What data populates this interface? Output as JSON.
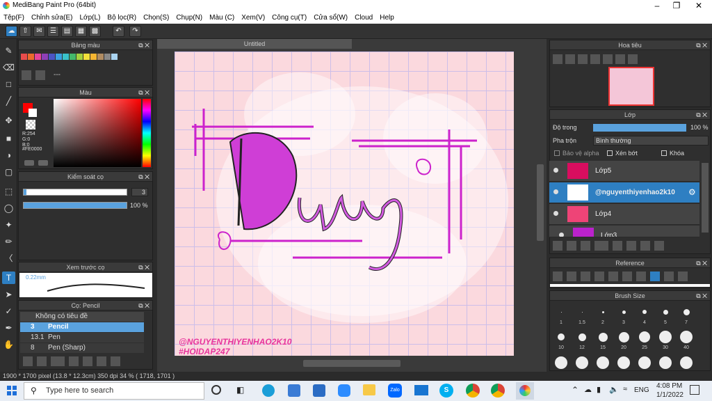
{
  "window": {
    "title": "MediBang Paint Pro (64bit)"
  },
  "menu": [
    "Tệp(F)",
    "Chỉnh sửa(E)",
    "Lớp(L)",
    "Bộ lọc(R)",
    "Chọn(S)",
    "Chụp(N)",
    "Màu (C)",
    "Xem(V)",
    "Công cụ(T)",
    "Cửa sổ(W)",
    "Cloud",
    "Help"
  ],
  "panels": {
    "palette": {
      "title": "Bảng màu",
      "dash": "---"
    },
    "color": {
      "title": "Màu",
      "r": "R:254",
      "g": "G:0",
      "b": "B:0",
      "hex": "#FE0000"
    },
    "brush_control": {
      "title": "Kiểm soát cọ",
      "size": "3",
      "opacity": "100 %"
    },
    "preview": {
      "title": "Xem trước cọ",
      "value": "0.22mm"
    },
    "brush": {
      "title": "Cọ: Pencil",
      "group": "Không có tiêu đề",
      "items": [
        {
          "size": "3",
          "name": "Pencil"
        },
        {
          "size": "13.1",
          "name": "Pen"
        },
        {
          "size": "8",
          "name": "Pen (Sharp)"
        }
      ]
    },
    "navigator": {
      "title": "Hoa tiêu"
    },
    "layers": {
      "title": "Lớp",
      "opacity_label": "Độ trong",
      "opacity_value": "100 %",
      "blend_label": "Pha trộn",
      "blend_value": "Bình thường",
      "protect_alpha": "Bảo vệ alpha",
      "clip": "Xén bớt",
      "lock": "Khóa",
      "items": [
        "Lớp5",
        "@nguyenthiyenhao2k10",
        "Lớp4",
        "Lớp3"
      ]
    },
    "reference": {
      "title": "Reference"
    },
    "brush_size": {
      "title": "Brush Size",
      "sizes": [
        "1",
        "1.5",
        "2",
        "3",
        "4",
        "5",
        "7",
        "10",
        "12",
        "15",
        "20",
        "25",
        "30",
        "40"
      ]
    }
  },
  "canvas": {
    "tab": "Untitled",
    "watermark1": "@NGUYENTHIYENHAO2K10",
    "watermark2": "#HOIDAP247"
  },
  "status": "1900 * 1700 pixel  (13.8 * 12.3cm)  350 dpi  34 %  ( 1718, 1701 )",
  "taskbar": {
    "search": "Type here to search",
    "lang": "ENG",
    "time": "4:08 PM",
    "date": "1/1/2022"
  },
  "colors": {
    "accent": "#2e7fc2",
    "primary": "#FE0000",
    "ink": "#cc22cc"
  }
}
